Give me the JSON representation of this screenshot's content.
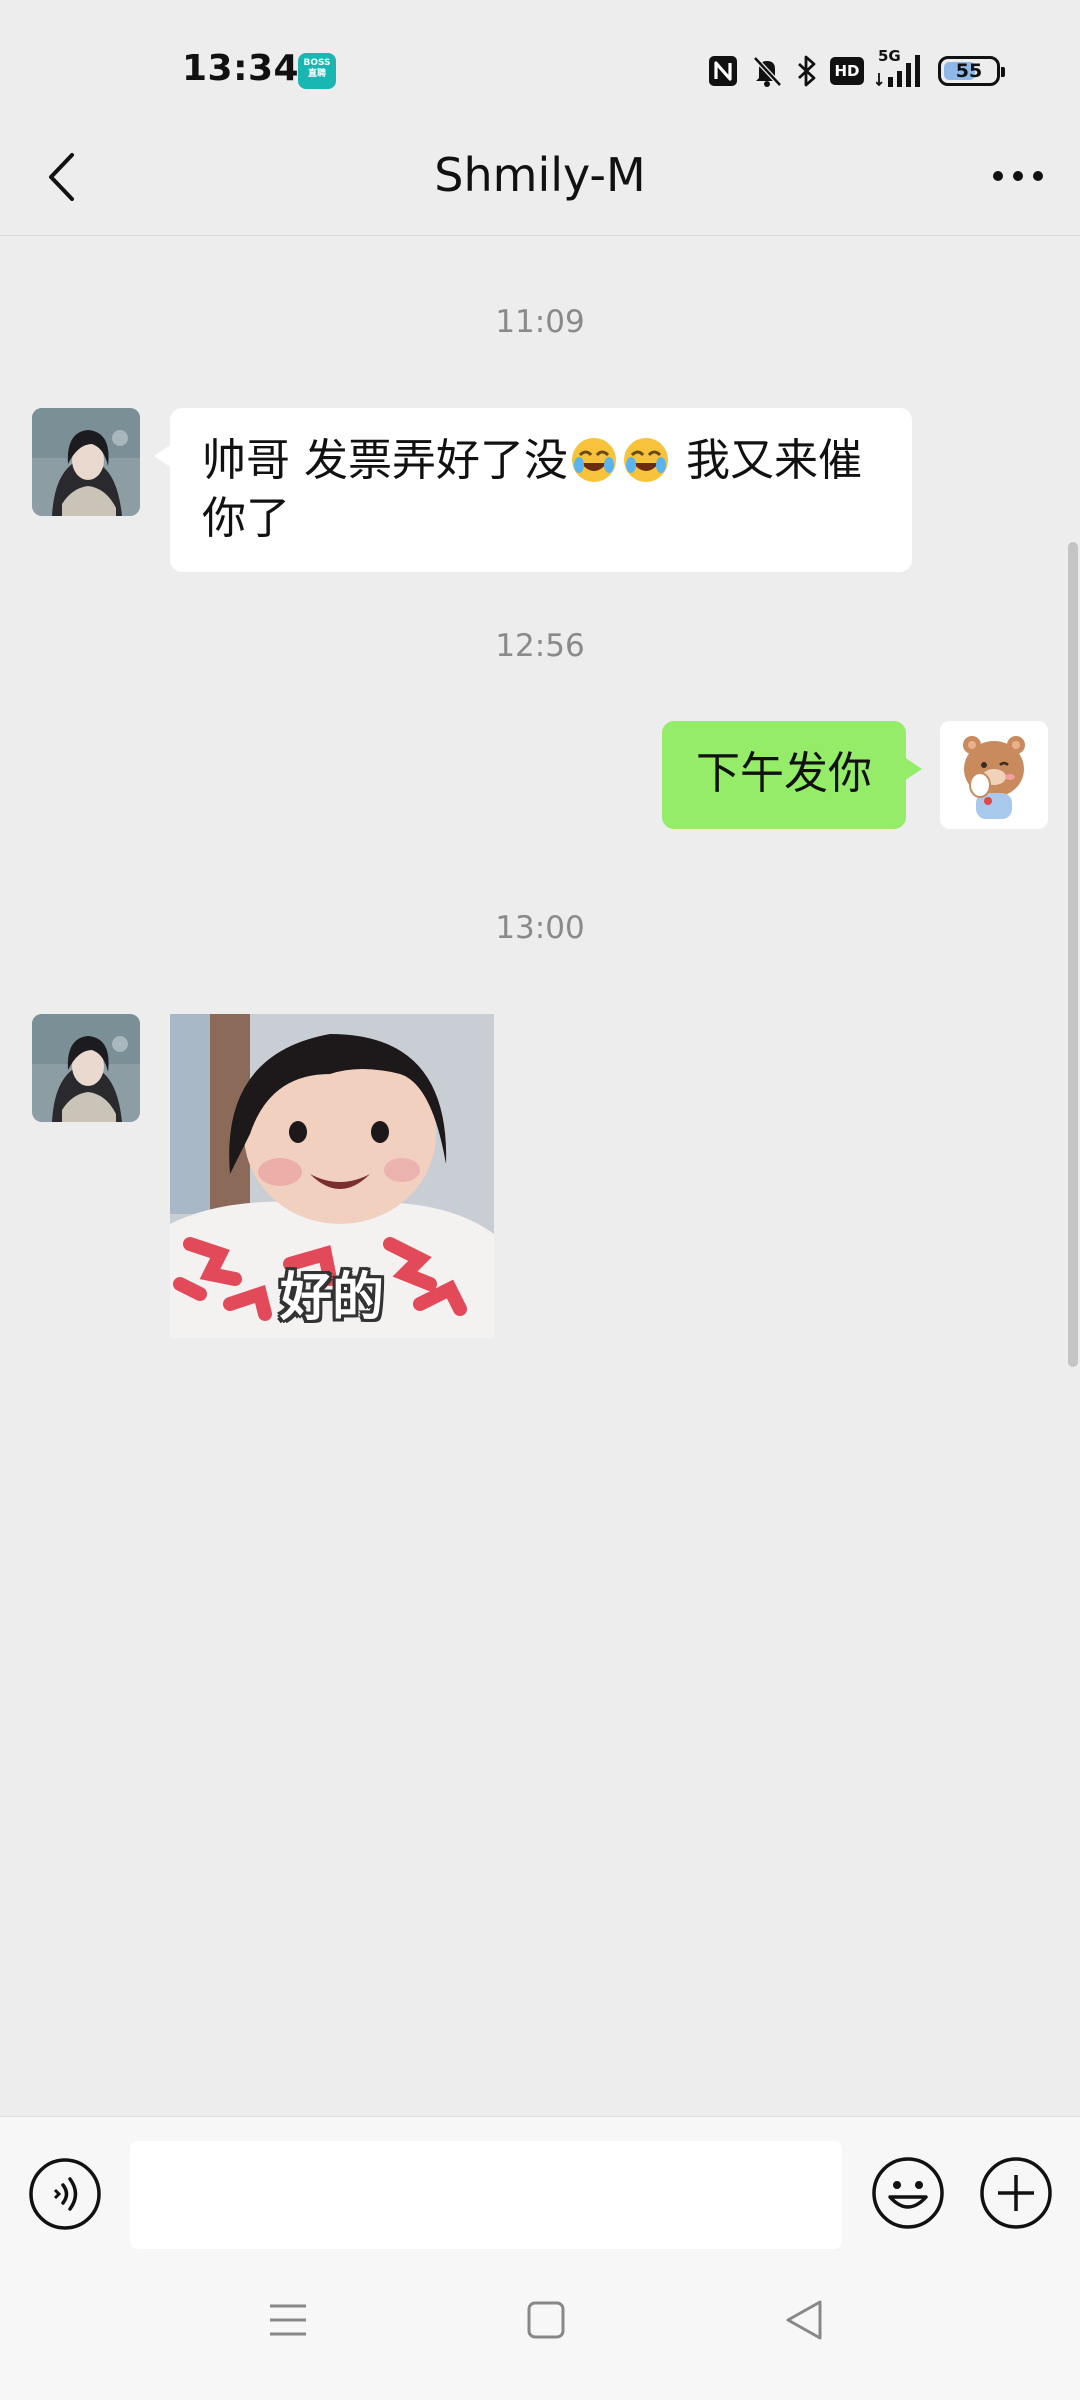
{
  "status_bar": {
    "time": "13:34",
    "app_badge": "BOSS直聘",
    "network": "5G",
    "hd_label": "HD",
    "battery": "55"
  },
  "header": {
    "title": "Shmily-M"
  },
  "messages": [
    {
      "type": "timestamp",
      "text": "11:09"
    },
    {
      "type": "text",
      "direction": "incoming",
      "text_before": "帅哥 发票弄好了没",
      "emoji_count": 2,
      "text_after": " 我又来催你了"
    },
    {
      "type": "timestamp",
      "text": "12:56"
    },
    {
      "type": "text",
      "direction": "outgoing",
      "text": "下午发你"
    },
    {
      "type": "timestamp",
      "text": "13:00"
    },
    {
      "type": "sticker",
      "direction": "incoming",
      "caption": "好的"
    }
  ],
  "colors": {
    "background": "#ededed",
    "outgoing_bubble": "#95ec69",
    "incoming_bubble": "#ffffff",
    "timestamp_text": "#8a8a8a"
  },
  "icons": {
    "back": "chevron-left-icon",
    "more": "more-dots-icon",
    "voice": "voice-icon",
    "emoji": "smiley-icon",
    "plus": "plus-icon",
    "status": [
      "nfc-icon",
      "mute-bell-icon",
      "bluetooth-icon",
      "hd-icon",
      "signal-icon",
      "battery-icon"
    ],
    "nav": [
      "menu-icon",
      "home-icon",
      "back-triangle-icon"
    ]
  },
  "input": {
    "value": "",
    "placeholder": ""
  }
}
